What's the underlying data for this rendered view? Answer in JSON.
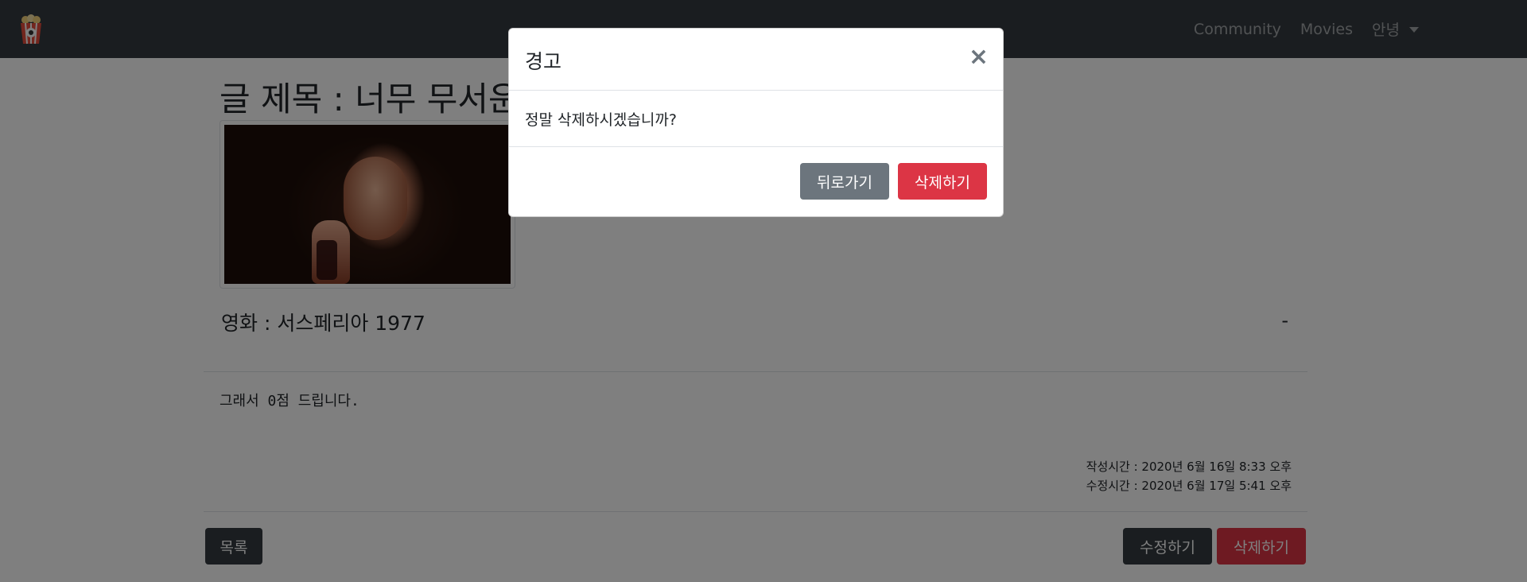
{
  "navbar": {
    "logo_icon": "popcorn-icon",
    "links": [
      {
        "label": "Community"
      },
      {
        "label": "Movies"
      },
      {
        "label": "안녕"
      }
    ]
  },
  "post": {
    "title": "글 제목 : 너무 무서운",
    "movie": "영화 : 서스페리아 1977",
    "right_mark": "-",
    "body": "그래서 0점 드립니다.",
    "created": "작성시간 : 2020년 6월 16일 8:33 오후",
    "updated": "수정시간 : 2020년 6월 17일 5:41 오후",
    "buttons": {
      "list": "목록",
      "edit": "수정하기",
      "delete": "삭제하기"
    }
  },
  "modal": {
    "title": "경고",
    "close": "×",
    "message": "정말 삭제하시겠습니까?",
    "back": "뒤로가기",
    "confirm": "삭제하기"
  },
  "colors": {
    "navbar": "#343a40",
    "danger": "#dc3545",
    "secondary": "#6c757d",
    "dark": "#343a40"
  }
}
